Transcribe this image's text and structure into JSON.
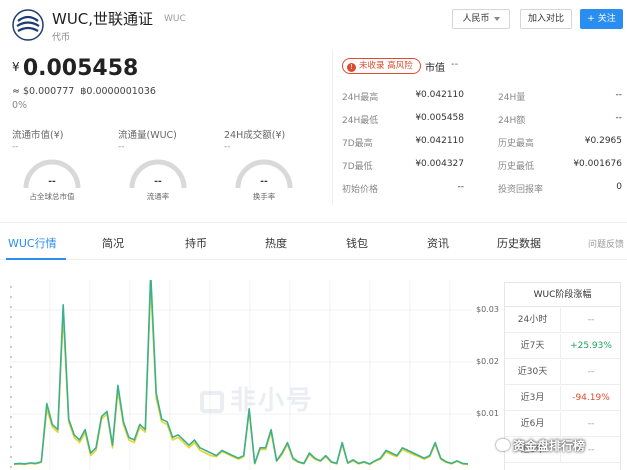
{
  "header": {
    "coin_name": "WUC,世联通证",
    "symbol": "WUC",
    "coin_type": "代币",
    "currency_button": "人民币",
    "compare_button": "加入对比",
    "follow_button": "+ 关注"
  },
  "price": {
    "currency_symbol": "¥",
    "value": "0.005458",
    "usd": "≈ $0.000777",
    "btc": "฿0.0000001036",
    "change_pct": "0%"
  },
  "supply_stats": [
    {
      "label": "流通市值(¥)",
      "value": "--",
      "gauge_value": "--",
      "gauge_label": "占全球总市值"
    },
    {
      "label": "流通量(WUC)",
      "value": "--",
      "gauge_value": "--",
      "gauge_label": "流通率"
    },
    {
      "label": "24H成交额(¥)",
      "value": "--",
      "gauge_value": "--",
      "gauge_label": "换手率"
    }
  ],
  "risk_badge": "未收录 高风险",
  "market_cap": {
    "label": "市值",
    "value": "--"
  },
  "stats_rows": [
    {
      "k1": "24H最高",
      "v1": "¥0.042110",
      "k2": "24H量",
      "v2": "--"
    },
    {
      "k1": "24H最低",
      "v1": "¥0.005458",
      "k2": "24H额",
      "v2": "--"
    },
    {
      "k1": "7D最高",
      "v1": "¥0.042110",
      "k2": "历史最高",
      "v2": "¥0.2965"
    },
    {
      "k1": "7D最低",
      "v1": "¥0.004327",
      "k2": "历史最低",
      "v2": "¥0.001676"
    },
    {
      "k1": "初始价格",
      "v1": "--",
      "k2": "投资回报率",
      "v2": "0"
    }
  ],
  "tabs": [
    {
      "label": "WUC行情",
      "active": true
    },
    {
      "label": "简况",
      "active": false
    },
    {
      "label": "持币",
      "active": false
    },
    {
      "label": "热度",
      "active": false
    },
    {
      "label": "钱包",
      "active": false
    },
    {
      "label": "资讯",
      "active": false
    },
    {
      "label": "历史数据",
      "active": false
    },
    {
      "label": "问题反馈",
      "active": false
    }
  ],
  "chart_data": {
    "type": "line",
    "y_ticks": [
      "$0.03",
      "$0.02",
      "$0.01"
    ],
    "ylim": [
      0,
      0.035
    ],
    "series": [
      {
        "color": "#3bb08f",
        "values": [
          0.0004,
          0.0005,
          0.0004,
          0.0006,
          0.0005,
          0.0008,
          0.012,
          0.008,
          0.007,
          0.031,
          0.009,
          0.006,
          0.005,
          0.007,
          0.0025,
          0.0035,
          0.0095,
          0.0105,
          0.004,
          0.0155,
          0.0085,
          0.0055,
          0.005,
          0.008,
          0.007,
          0.037,
          0.014,
          0.009,
          0.0085,
          0.0055,
          0.006,
          0.005,
          0.004,
          0.005,
          0.0035,
          0.003,
          0.0025,
          0.002,
          0.003,
          0.0025,
          0.002,
          0.0015,
          0.002,
          0.011,
          0.0005,
          0.0035,
          0.0035,
          0.007,
          0.001,
          0.0025,
          0.0045,
          0.0015,
          0.0008,
          0.0005,
          0.0025,
          0.0015,
          0.001,
          0.002,
          0.0008,
          0.0005,
          0.0045,
          0.0006,
          0.0012,
          0.0005,
          0.0008,
          0.0004,
          0.001,
          0.0015,
          0.003,
          0.0025,
          0.002,
          0.0035,
          0.003,
          0.0025,
          0.002,
          0.0015,
          0.002,
          0.0045,
          0.0015,
          0.0008,
          0.0005,
          0.001,
          0.0005,
          0.0004
        ]
      },
      {
        "color": "#e8d42a",
        "values": [
          0.0003,
          0.0004,
          0.0003,
          0.0005,
          0.0004,
          0.0007,
          0.011,
          0.0075,
          0.0065,
          0.029,
          0.0085,
          0.0055,
          0.0045,
          0.0065,
          0.002,
          0.003,
          0.009,
          0.01,
          0.0035,
          0.0145,
          0.008,
          0.005,
          0.0045,
          0.0075,
          0.0065,
          0.035,
          0.013,
          0.0085,
          0.008,
          0.005,
          0.0055,
          0.0045,
          0.0035,
          0.0045,
          0.003,
          0.0025,
          0.002,
          0.0018,
          0.0028,
          0.0023,
          0.0018,
          0.0013,
          0.0018,
          0.0105,
          0.0004,
          0.0032,
          0.0032,
          0.0065,
          0.0009,
          0.0022,
          0.0042,
          0.0013,
          0.0007,
          0.0004,
          0.0022,
          0.0013,
          0.0009,
          0.0018,
          0.0007,
          0.0004,
          0.0042,
          0.0005,
          0.001,
          0.0004,
          0.0007,
          0.0003,
          0.0009,
          0.0013,
          0.0027,
          0.0022,
          0.0018,
          0.0032,
          0.0027,
          0.0022,
          0.0018,
          0.0013,
          0.0018,
          0.0042,
          0.0013,
          0.0007,
          0.0004,
          0.0009,
          0.0004,
          0.0003
        ]
      }
    ]
  },
  "watermark": "非小号",
  "phase_table": {
    "title": "WUC阶段涨幅",
    "rows": [
      {
        "label": "24小时",
        "value": "--",
        "trend": "none"
      },
      {
        "label": "近7天",
        "value": "+25.93%",
        "trend": "up"
      },
      {
        "label": "近30天",
        "value": "--",
        "trend": "none"
      },
      {
        "label": "近3月",
        "value": "-94.19%",
        "trend": "down"
      },
      {
        "label": "近6月",
        "value": "--",
        "trend": "none"
      },
      {
        "label": "近1年",
        "value": "--",
        "trend": "none"
      }
    ]
  },
  "corner_watermark": "资金盘排行榜"
}
